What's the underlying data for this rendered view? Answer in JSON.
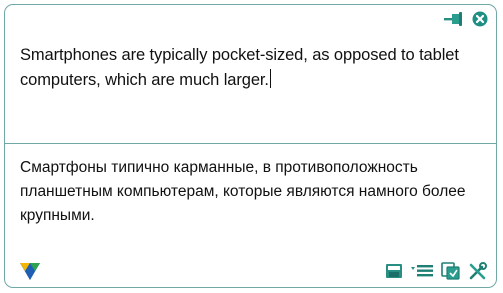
{
  "toolbar_top": {
    "pin_icon": "pin-icon",
    "close_icon": "close-icon"
  },
  "source": {
    "text": "Smartphones are typically pocket-sized, as opposed to tablet computers, which are much larger."
  },
  "translation": {
    "text": "Смартфоны типично карманные, в противоположность планшетным компьютерам, которые являются намного более крупными."
  },
  "bottom_toolbar": {
    "logo_icon": "logo-icon",
    "icons": [
      "save-icon",
      "list-icon",
      "copy-icon",
      "settings-icon"
    ]
  },
  "colors": {
    "border": "#6fa8a6",
    "accent_teal": "#2a9d8f",
    "logo_yellow": "#f2b705",
    "logo_green": "#2ea44f",
    "logo_blue": "#1e5fb4"
  }
}
